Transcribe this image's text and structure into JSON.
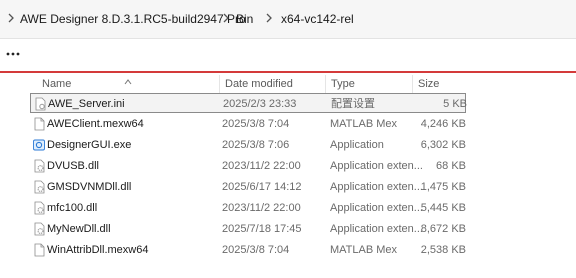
{
  "breadcrumb": {
    "items": [
      "AWE Designer 8.D.3.1.RC5-build2947 Pro",
      "Bin",
      "x64-vc142-rel"
    ]
  },
  "toolbar": {
    "more_label": "..."
  },
  "columns": {
    "name": "Name",
    "date": "Date modified",
    "type": "Type",
    "size": "Size"
  },
  "files": [
    {
      "name": "AWE_Server.ini",
      "date": "2025/2/3 23:33",
      "type": "配置设置",
      "size": "5 KB",
      "icon": "settings-file-icon",
      "selected": true
    },
    {
      "name": "AWEClient.mexw64",
      "date": "2025/3/8 7:04",
      "type": "MATLAB Mex",
      "size": "4,246 KB",
      "icon": "file-icon",
      "selected": false
    },
    {
      "name": "DesignerGUI.exe",
      "date": "2025/3/8 7:06",
      "type": "Application",
      "size": "6,302 KB",
      "icon": "exe-icon",
      "selected": false
    },
    {
      "name": "DVUSB.dll",
      "date": "2023/11/2 22:00",
      "type": "Application exten...",
      "size": "68 KB",
      "icon": "dll-icon",
      "selected": false
    },
    {
      "name": "GMSDVNMDll.dll",
      "date": "2025/6/17 14:12",
      "type": "Application exten...",
      "size": "1,475 KB",
      "icon": "dll-icon",
      "selected": false
    },
    {
      "name": "mfc100.dll",
      "date": "2023/11/2 22:00",
      "type": "Application exten...",
      "size": "5,445 KB",
      "icon": "dll-icon",
      "selected": false
    },
    {
      "name": "MyNewDll.dll",
      "date": "2025/7/18 17:45",
      "type": "Application exten...",
      "size": "8,672 KB",
      "icon": "dll-icon",
      "selected": false
    },
    {
      "name": "WinAttribDll.mexw64",
      "date": "2025/3/8 7:04",
      "type": "MATLAB Mex",
      "size": "2,538 KB",
      "icon": "file-icon",
      "selected": false
    }
  ],
  "colors": {
    "accent_line": "#d43a3a",
    "selection_border": "#8a8a8a",
    "exe_icon": "#2b79d6",
    "dll_gear": "#9a9a9a"
  }
}
